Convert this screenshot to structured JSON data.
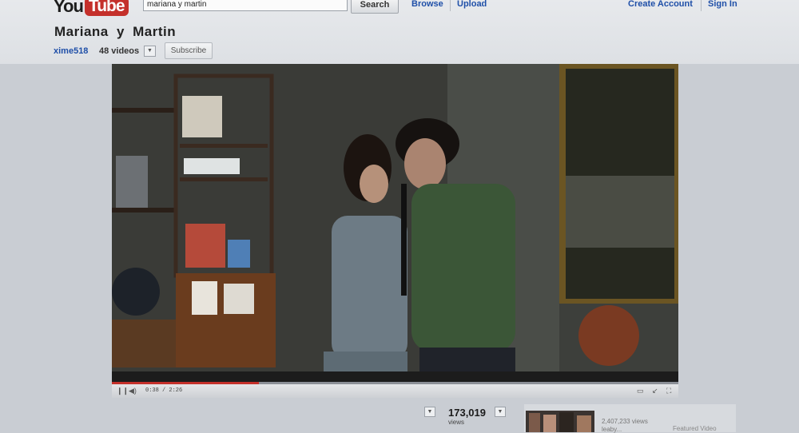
{
  "header": {
    "logo_you": "You",
    "logo_tube": "Tube",
    "search_value": "mariana y martin",
    "search_button": "Search",
    "nav": [
      "Browse",
      "Upload"
    ],
    "account": [
      "Create Account",
      "Sign In"
    ]
  },
  "video_info": {
    "title": "Mariana  y  Martin",
    "channel": "xime518",
    "video_count": "48 videos",
    "subscribe": "Subscribe"
  },
  "player": {
    "time": "0:38 / 2:26",
    "progress_fraction": 0.26,
    "brand_color": "#c4302b"
  },
  "stats": {
    "views": "173,019",
    "views_label": "views"
  },
  "related": {
    "views": "2,407,233 views",
    "author": "leaby...",
    "tag": "Featured Video"
  }
}
